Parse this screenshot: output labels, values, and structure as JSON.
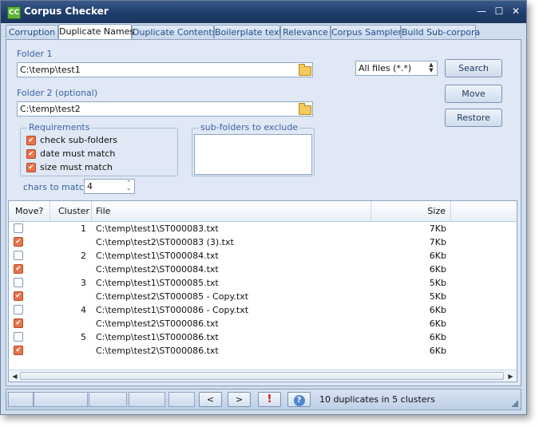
{
  "window": {
    "title": "Corpus Checker",
    "app_icon": "CC",
    "minimize": "—",
    "maximize": "☐",
    "close": "✕"
  },
  "tabs": [
    {
      "label": "Corruption",
      "active": false
    },
    {
      "label": "Duplicate Names",
      "active": true
    },
    {
      "label": "Duplicate Contents",
      "active": false
    },
    {
      "label": "Boilerplate text",
      "active": false
    },
    {
      "label": "Relevance",
      "active": false
    },
    {
      "label": "Corpus Sampler",
      "active": false
    },
    {
      "label": "Build Sub-corpora",
      "active": false
    }
  ],
  "folder1": {
    "label": "Folder 1",
    "value": "C:\\temp\\test1"
  },
  "folder2": {
    "label": "Folder 2 (optional)",
    "value": "C:\\temp\\test2"
  },
  "file_filter": {
    "selected": "All files (*.*)"
  },
  "buttons": {
    "search": "Search",
    "move": "Move",
    "restore": "Restore"
  },
  "requirements": {
    "title": "Requirements",
    "items": [
      {
        "label": "check sub-folders",
        "checked": true
      },
      {
        "label": "date must match",
        "checked": true
      },
      {
        "label": "size must match",
        "checked": true
      }
    ]
  },
  "subfolders": {
    "title": "sub-folders to exclude"
  },
  "chars_to_match": {
    "label": "chars to match",
    "value": "4"
  },
  "grid": {
    "headers": {
      "move": "Move?",
      "cluster": "Cluster",
      "file": "File",
      "size": "Size"
    },
    "rows": [
      {
        "move": false,
        "cluster": "1",
        "file": "C:\\temp\\test1\\ST000083.txt",
        "size": "7Kb"
      },
      {
        "move": true,
        "cluster": "",
        "file": "C:\\temp\\test2\\ST000083 (3).txt",
        "size": "7Kb"
      },
      {
        "move": false,
        "cluster": "2",
        "file": "C:\\temp\\test1\\ST000084.txt",
        "size": "6Kb"
      },
      {
        "move": true,
        "cluster": "",
        "file": "C:\\temp\\test2\\ST000084.txt",
        "size": "6Kb"
      },
      {
        "move": false,
        "cluster": "3",
        "file": "C:\\temp\\test1\\ST000085.txt",
        "size": "5Kb"
      },
      {
        "move": true,
        "cluster": "",
        "file": "C:\\temp\\test2\\ST000085 - Copy.txt",
        "size": "5Kb"
      },
      {
        "move": false,
        "cluster": "4",
        "file": "C:\\temp\\test1\\ST000086 - Copy.txt",
        "size": "6Kb"
      },
      {
        "move": true,
        "cluster": "",
        "file": "C:\\temp\\test2\\ST000086.txt",
        "size": "6Kb"
      },
      {
        "move": false,
        "cluster": "5",
        "file": "C:\\temp\\test1\\ST000086.txt",
        "size": "6Kb"
      },
      {
        "move": true,
        "cluster": "",
        "file": "C:\\temp\\test2\\ST000086.txt",
        "size": "6Kb"
      }
    ]
  },
  "statusbar": {
    "prev": "<",
    "next": ">",
    "alert": "!",
    "help": "?",
    "text": "10 duplicates in 5 clusters"
  },
  "colors": {
    "checked_box": "#e9734a",
    "title_bar": "#1f3d6b",
    "panel": "#dfe8f4"
  }
}
